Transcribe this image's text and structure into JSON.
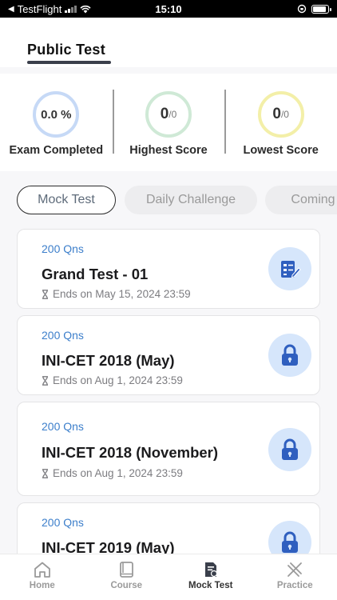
{
  "status_bar": {
    "carrier": "TestFlight",
    "time": "15:10"
  },
  "header": {
    "title": "Public Test"
  },
  "stats": [
    {
      "value": "0.0 %",
      "label": "Exam Completed",
      "color": "#c6d9f6"
    },
    {
      "value": "0",
      "total": "/0",
      "label": "Highest Score",
      "color": "#cfe9d6"
    },
    {
      "value": "0",
      "total": "/0",
      "label": "Lowest Score",
      "color": "#f3efa8"
    }
  ],
  "tabs": [
    {
      "label": "Mock Test",
      "active": true
    },
    {
      "label": "Daily Challenge",
      "active": false
    },
    {
      "label": "Coming",
      "active": false
    }
  ],
  "tests": [
    {
      "questions": "200 Qns",
      "title": "Grand Test - 01",
      "ends": "Ends on May 15, 2024 23:59",
      "icon": "exam-icon"
    },
    {
      "questions": "200 Qns",
      "title": "INI-CET 2018 (May)",
      "ends": "Ends on Aug 1, 2024 23:59",
      "icon": "lock-icon"
    },
    {
      "questions": "200 Qns",
      "title": "INI-CET 2018 (November)",
      "ends": "Ends on Aug 1, 2024 23:59",
      "icon": "lock-icon"
    },
    {
      "questions": "200 Qns",
      "title": "INI-CET 2019 (May)",
      "ends": "",
      "icon": "lock-icon"
    }
  ],
  "nav": [
    {
      "label": "Home",
      "icon": "home-icon",
      "active": false
    },
    {
      "label": "Course",
      "icon": "book-icon",
      "active": false
    },
    {
      "label": "Mock Test",
      "icon": "mock-test-icon",
      "active": true
    },
    {
      "label": "Practice",
      "icon": "practice-icon",
      "active": false
    }
  ],
  "colors": {
    "accent": "#3d7fcb",
    "icon_bg": "#d6e6fb",
    "icon_fg": "#2f5fbf"
  }
}
